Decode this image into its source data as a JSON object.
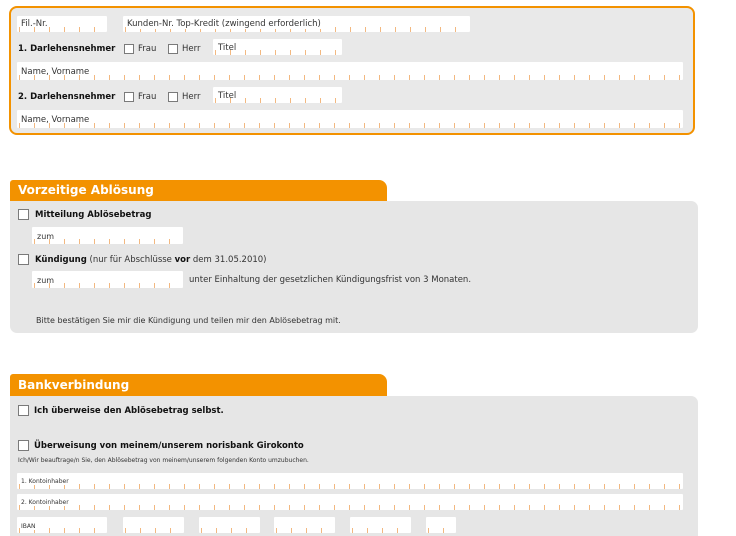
{
  "personal": {
    "fil_nr": "Fil.-Nr.",
    "kunden_nr": "Kunden-Nr. Top-Kredit (zwingend erforderlich)",
    "borrower1": "1. Darlehensnehmer",
    "borrower2": "2. Darlehensnehmer",
    "frau": "Frau",
    "herr": "Herr",
    "titel": "Titel",
    "name": "Name, Vorname"
  },
  "repayment": {
    "title": "Vorzeitige Ablösung",
    "mitteilung": "Mitteilung Ablösebetrag",
    "zum": "zum",
    "kuendigung": "Kündigung",
    "hint_pre": "(nur für Abschlüsse",
    "hint_bold": "vor",
    "hint_post": "dem 31.05.2010)",
    "frist": "unter Einhaltung der gesetzlichen Kündigungsfrist von 3 Monaten.",
    "confirm": "Bitte bestätigen Sie mir die Kündigung und teilen mir den Ablösebetrag mit."
  },
  "bank": {
    "title": "Bankverbindung",
    "self_transfer": "Ich überweise den Ablösebetrag selbst.",
    "giro": "Überweisung von meinem/unserem norisbank Girokonto",
    "authorize": "Ich/Wir beauftrage/n Sie, den Ablösebetrag von meinem/unserem folgenden Konto umzubuchen.",
    "holder1": "1. Kontoinhaber",
    "holder2": "2. Kontoinhaber",
    "iban": "IBAN"
  },
  "colors": {
    "accent": "#f39200",
    "panel": "#e6e6e6"
  }
}
